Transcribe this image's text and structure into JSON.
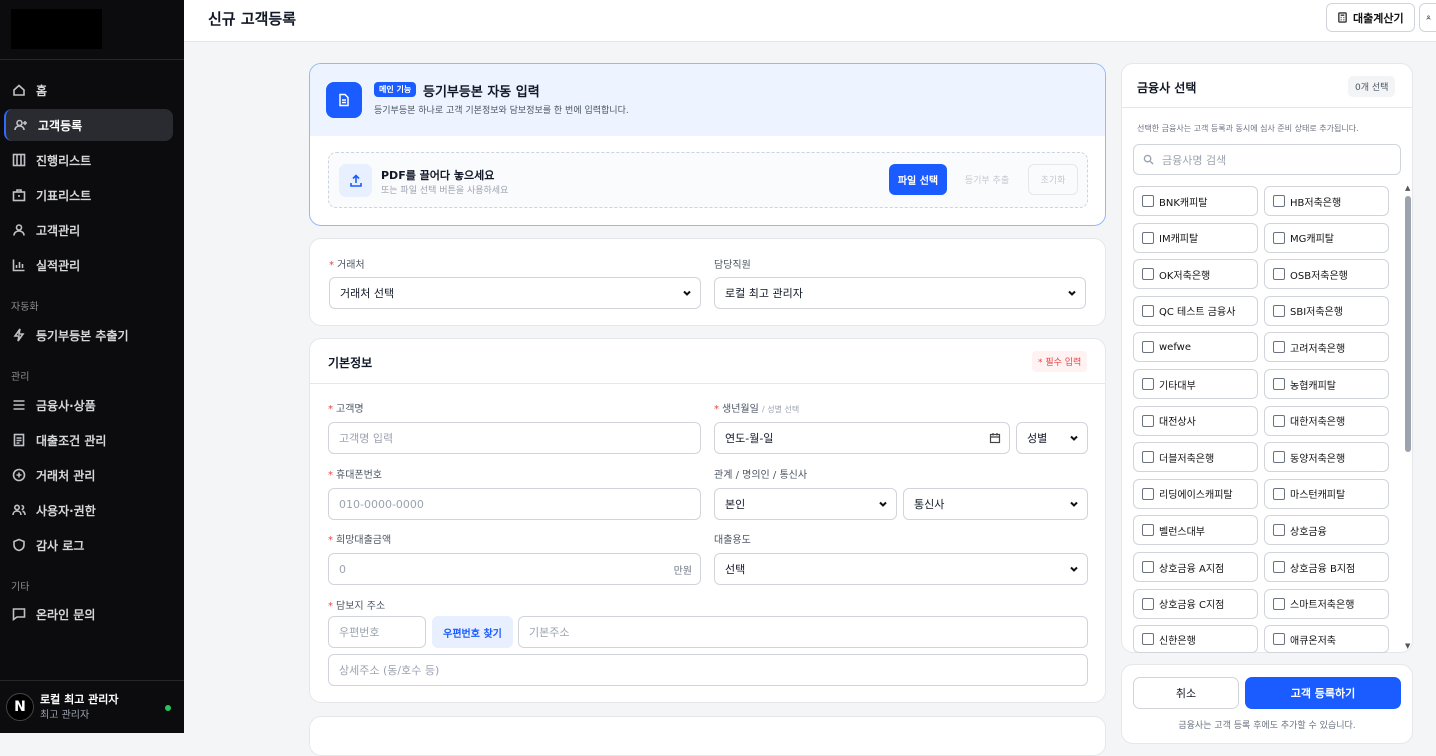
{
  "sidebar": {
    "nav": [
      "홈",
      "고객등록",
      "진행리스트",
      "기표리스트",
      "고객관리",
      "실적관리"
    ],
    "sections": {
      "auto": "자동화",
      "admin": "관리",
      "etc": "기타"
    },
    "auto_items": [
      "등기부등본 추출기"
    ],
    "admin_items": [
      "금융사·상품",
      "대출조건 관리",
      "거래처 관리",
      "사용자·권한",
      "감사 로그"
    ],
    "etc_items": [
      "온라인 문의"
    ],
    "user": {
      "avatar": "N",
      "name": "로컬 최고 관리자",
      "role": "최고 관리자"
    }
  },
  "header": {
    "title": "신규 고객등록",
    "calc_button": "대출계산기"
  },
  "registry": {
    "badge": "메인 기능",
    "title": "등기부등본 자동 입력",
    "subtitle": "등기부등본 하나로 고객 기본정보와 담보정보를 한 번에 입력합니다.",
    "drop_title": "PDF를 끌어다 놓으세요",
    "drop_sub": "또는 파일 선택 버튼을 사용하세요",
    "file_button": "파일 선택",
    "extract_button": "등기부 추출",
    "reset_button": "초기화"
  },
  "assign": {
    "partner_label": "거래처",
    "partner_value": "거래처 선택",
    "staff_label": "담당직원",
    "staff_value": "로컬 최고 관리자"
  },
  "basic": {
    "title": "기본정보",
    "required_badge": "* 필수 입력",
    "name_label": "고객명",
    "name_placeholder": "고객명 입력",
    "birth_label": "생년월일",
    "birth_hint": "/ 성별 선택",
    "birth_value": "연도-월-일",
    "gender_value": "성별",
    "phone_label": "휴대폰번호",
    "phone_placeholder": "010-0000-0000",
    "relation_label": "관계 / 명의인 / 통신사",
    "relation_value": "본인",
    "carrier_value": "통신사",
    "amount_label": "희망대출금액",
    "amount_placeholder": "0",
    "amount_unit": "만원",
    "purpose_label": "대출용도",
    "purpose_value": "선택",
    "address_label": "담보지 주소",
    "zip_placeholder": "우편번호",
    "zip_button": "우편번호 찾기",
    "addr_placeholder": "기본주소",
    "detail_placeholder": "상세주소 (동/호수 등)"
  },
  "lenders": {
    "title": "금융사 선택",
    "count_badge": "0개 선택",
    "desc": "선택한 금융사는 고객 등록과 동시에 심사 준비 상태로 추가됩니다.",
    "search_placeholder": "금융사명 검색",
    "items": [
      "BNK캐피탈",
      "HB저축은행",
      "IM캐피탈",
      "MG캐피탈",
      "OK저축은행",
      "OSB저축은행",
      "QC 테스트 금융사",
      "SBI저축은행",
      "wefwe",
      "고려저축은행",
      "기타대부",
      "농협캐피탈",
      "대전상사",
      "대한저축은행",
      "더블저축은행",
      "동양저축은행",
      "리딩에이스캐피탈",
      "마스턴캐피탈",
      "벨런스대부",
      "상호금융",
      "상호금융 A지점",
      "상호금융 B지점",
      "상호금융 C지점",
      "스마트저축은행",
      "신한은행",
      "애큐온저축"
    ]
  },
  "actions": {
    "cancel": "취소",
    "submit": "고객 등록하기",
    "note": "금융사는 고객 등록 후에도 추가할 수 있습니다."
  },
  "colors": {
    "accent": "#1a5cff",
    "sidebar_bg": "#0c0c0e",
    "required": "#ef4444"
  }
}
